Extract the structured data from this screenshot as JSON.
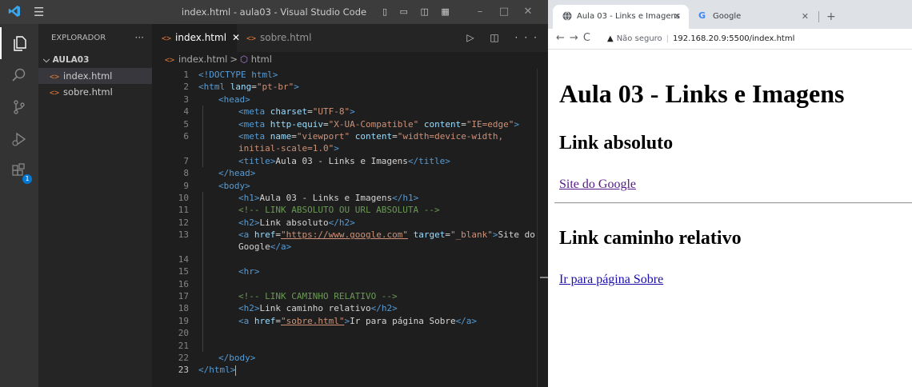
{
  "vscode": {
    "window_title": "index.html - aula03 - Visual Studio Code",
    "menu_icon": "hamburger-menu-icon",
    "layout_controls": "▯ ▭ ◫ ▦",
    "window_controls": {
      "minimize": "–",
      "maximize": "□",
      "close": "✕"
    },
    "explorer": {
      "header": "EXPLORADOR",
      "more": "···",
      "folder": "AULA03",
      "files": [
        {
          "name": "index.html",
          "selected": true
        },
        {
          "name": "sobre.html",
          "selected": false
        }
      ]
    },
    "tabs": [
      {
        "label": "index.html",
        "active": true,
        "close": "✕"
      },
      {
        "label": "sobre.html",
        "active": false
      }
    ],
    "editor_actions": "▷ ◫ ···",
    "breadcrumb": {
      "file": "index.html",
      "separator": ">",
      "node": "html"
    },
    "code": {
      "line_numbers": [
        "1",
        "2",
        "3",
        "4",
        "5",
        "6",
        "",
        "7",
        "8",
        "9",
        "10",
        "11",
        "12",
        "13",
        "",
        "14",
        "15",
        "16",
        "17",
        "18",
        "19",
        "20",
        "21",
        "22",
        "23"
      ],
      "lines": [
        [
          "<!DOCTYPE",
          " html",
          ">"
        ],
        [
          "<html",
          " lang",
          "=",
          "\"pt-br\"",
          ">"
        ],
        [
          "<head>"
        ],
        [
          "<meta",
          " charset",
          "=",
          "\"UTF-8\"",
          ">"
        ],
        [
          "<meta",
          " http-equiv",
          "=",
          "\"X-UA-Compatible\"",
          " content",
          "=",
          "\"IE=edge\"",
          ">"
        ],
        [
          "<meta",
          " name",
          "=",
          "\"viewport\"",
          " content",
          "=",
          "\"width=device-width,"
        ],
        [
          "initial-scale=1.0\"",
          ">"
        ],
        [
          "<title>",
          "Aula 03 - Links e Imagens",
          "</title>"
        ],
        [
          "</head>"
        ],
        [
          "<body>"
        ],
        [
          "<h1>",
          "Aula 03 - Links e Imagens",
          "</h1>"
        ],
        [
          "<!-- LINK ABSOLUTO OU URL ABSOLUTA -->"
        ],
        [
          "<h2>",
          "Link absoluto",
          "</h2>"
        ],
        [
          "<a",
          " href",
          "=",
          "\"https://www.google.com\"",
          " target",
          "=",
          "\"_blank\"",
          ">",
          "Site do"
        ],
        [
          "Google",
          "</a>"
        ],
        [
          ""
        ],
        [
          "<hr>"
        ],
        [
          ""
        ],
        [
          "<!-- LINK CAMINHO RELATIVO -->"
        ],
        [
          "<h2>",
          "Link caminho relativo",
          "</h2>"
        ],
        [
          "<a",
          " href",
          "=",
          "\"sobre.html\"",
          ">",
          "Ir para página Sobre",
          "</a>"
        ],
        [
          ""
        ],
        [
          ""
        ],
        [
          "</body>"
        ],
        [
          "</html>"
        ]
      ]
    }
  },
  "browser": {
    "tabs": [
      {
        "title": "Aula 03 - Links e Imagens",
        "close": "✕"
      },
      {
        "title": "Google",
        "close": "✕"
      }
    ],
    "new_tab": "+",
    "nav": {
      "back": "←",
      "forward": "→",
      "reload": "C"
    },
    "security_label": "Não seguro",
    "url": "192.168.20.9:5500/index.html",
    "page": {
      "h1": "Aula 03 - Links e Imagens",
      "h2_absolute": "Link absoluto",
      "link_google": "Site do Google",
      "h2_relative": "Link caminho relativo",
      "link_sobre": "Ir para página Sobre"
    }
  },
  "colors": {
    "vscode_bg": "#1e1e1e",
    "tag": "#569cd6",
    "attr": "#9cdcfe",
    "string": "#ce9178",
    "comment": "#6a9955",
    "visited_link": "#551a8b",
    "link": "#1a0dab"
  }
}
